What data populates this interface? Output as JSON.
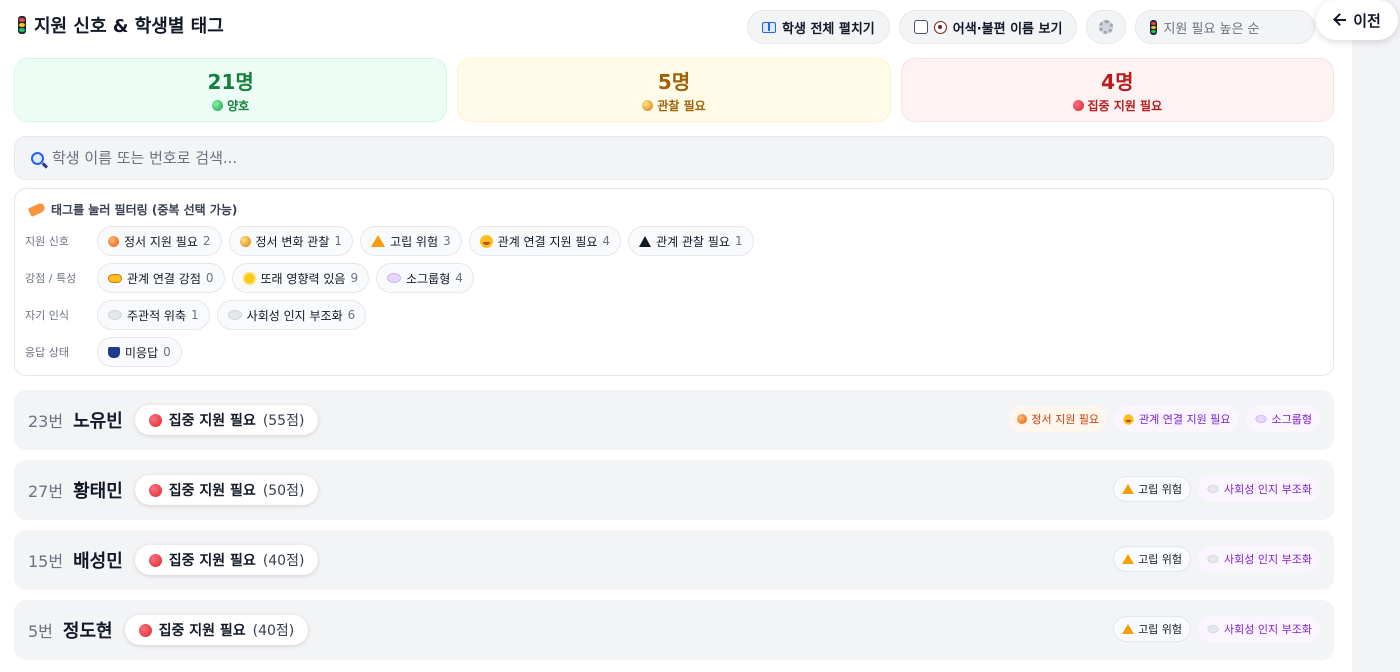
{
  "header": {
    "title": "지원 신호 & 학생별 태그",
    "title_icon": "traffic-light-icon",
    "expand_all_label": "학생 전체 펼치기",
    "expand_all_icon": "book-icon",
    "awkward_names_label": "어색·불편 이름 보기",
    "awkward_names_icon": "eye-icon",
    "awkward_names_checked": false,
    "settings_icon": "gear-icon",
    "sort_value": "지원 필요 높은 순",
    "sort_icon": "traffic-light-icon",
    "back_label": "이전",
    "back_icon": "arrow-left-icon"
  },
  "summary": [
    {
      "count": "21명",
      "label": "양호",
      "color": "#15803d"
    },
    {
      "count": "5명",
      "label": "관찰 필요",
      "color": "#a16207"
    },
    {
      "count": "4명",
      "label": "집중 지원 필요",
      "color": "#b91c1c"
    }
  ],
  "search": {
    "placeholder": "학생 이름 또는 번호로 검색...",
    "value": "",
    "icon": "magnifier-icon"
  },
  "filters": {
    "hint": "태그를 눌러 필터링 (중복 선택 가능)",
    "hint_icon": "tag-icon",
    "groups": [
      {
        "label": "지원 신호",
        "chips": [
          {
            "icon": "orange-circle-icon",
            "label": "정서 지원 필요",
            "count": "2"
          },
          {
            "icon": "yellow-circle-icon",
            "label": "정서 변화 관찰",
            "count": "1"
          },
          {
            "icon": "warning-icon",
            "label": "고립 위험",
            "count": "3"
          },
          {
            "icon": "grimace-face-icon",
            "label": "관계 연결 지원 필요",
            "count": "4"
          },
          {
            "icon": "black-warning-icon",
            "label": "관계 관찰 필요",
            "count": "1"
          }
        ]
      },
      {
        "label": "강점 / 특성",
        "chips": [
          {
            "icon": "handshake-icon",
            "label": "관계 연결 강점",
            "count": "0"
          },
          {
            "icon": "sun-icon",
            "label": "또래 영향력 있음",
            "count": "9"
          },
          {
            "icon": "speech-bubble-icon",
            "label": "소그룹형",
            "count": "4"
          }
        ]
      },
      {
        "label": "자기 인식",
        "chips": [
          {
            "icon": "thought-bubble-icon",
            "label": "주관적 위축",
            "count": "1"
          },
          {
            "icon": "thought-bubble-icon",
            "label": "사회성 인지 부조화",
            "count": "6"
          }
        ]
      },
      {
        "label": "응답 상태",
        "chips": [
          {
            "icon": "thumbs-down-icon",
            "label": "미응답",
            "count": "0"
          }
        ]
      }
    ]
  },
  "students": [
    {
      "number": "23번",
      "name": "노유빈",
      "status": "집중 지원 필요",
      "score": "(55점)",
      "tags": [
        {
          "icon": "orange-circle-icon",
          "label": "정서 지원 필요",
          "style": "orange"
        },
        {
          "icon": "grimace-face-icon",
          "label": "관계 연결 지원 필요",
          "style": "purple"
        },
        {
          "icon": "speech-bubble-icon",
          "label": "소그룹형",
          "style": "purple"
        }
      ]
    },
    {
      "number": "27번",
      "name": "황태민",
      "status": "집중 지원 필요",
      "score": "(50점)",
      "tags": [
        {
          "icon": "warning-icon",
          "label": "고립 위험",
          "style": "gray"
        },
        {
          "icon": "thought-bubble-icon",
          "label": "사회성 인지 부조화",
          "style": "purple"
        }
      ]
    },
    {
      "number": "15번",
      "name": "배성민",
      "status": "집중 지원 필요",
      "score": "(40점)",
      "tags": [
        {
          "icon": "warning-icon",
          "label": "고립 위험",
          "style": "gray"
        },
        {
          "icon": "thought-bubble-icon",
          "label": "사회성 인지 부조화",
          "style": "purple"
        }
      ]
    },
    {
      "number": "5번",
      "name": "정도현",
      "status": "집중 지원 필요",
      "score": "(40점)",
      "tags": [
        {
          "icon": "warning-icon",
          "label": "고립 위험",
          "style": "gray"
        },
        {
          "icon": "thought-bubble-icon",
          "label": "사회성 인지 부조화",
          "style": "purple"
        }
      ]
    }
  ]
}
